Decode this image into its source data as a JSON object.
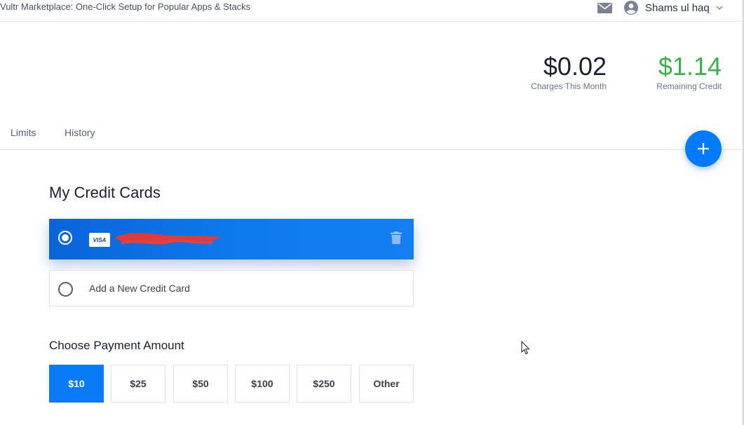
{
  "topbar": {
    "news": "Vultr Marketplace: One-Click Setup for Popular Apps & Stacks",
    "username": "Shams ul haq",
    "icons": [
      "mail-icon",
      "user-avatar-icon",
      "chevron-down-icon"
    ]
  },
  "stats": {
    "charges_value": "$0.02",
    "charges_label": "Charges This Month",
    "credit_value": "$1.14",
    "credit_label": "Remaining Credit"
  },
  "tabs": [
    {
      "label": "Limits"
    },
    {
      "label": "History"
    }
  ],
  "credit_cards": {
    "heading": "My Credit Cards",
    "cards": [
      {
        "brand": "VISA",
        "selected": true
      }
    ],
    "add_label": "Add a New Credit Card"
  },
  "payment": {
    "heading": "Choose Payment Amount",
    "amounts": [
      "$10",
      "$25",
      "$50",
      "$100",
      "$250",
      "Other"
    ],
    "selected": "$10"
  },
  "colors": {
    "accent": "#007bfc",
    "credit_green": "#3dae4c",
    "text_dark": "#1b2033"
  }
}
